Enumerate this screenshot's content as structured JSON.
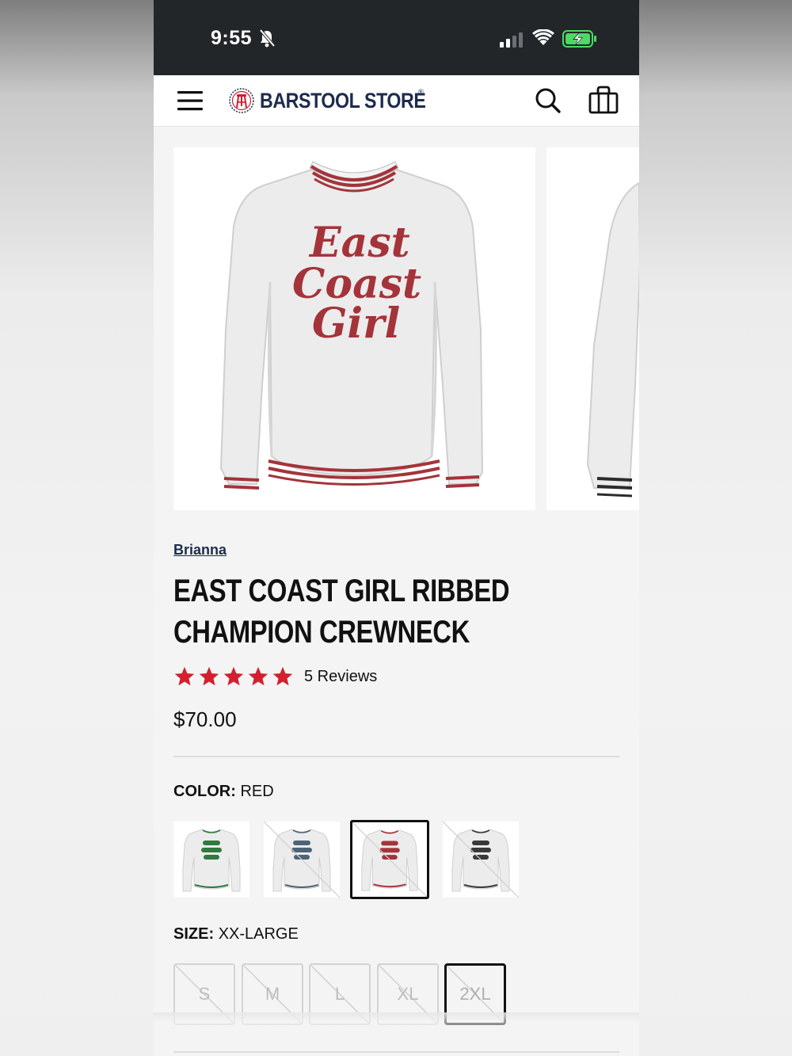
{
  "status_bar": {
    "time": "9:55"
  },
  "header": {
    "logo_text": "BARSTOOL STORE",
    "icons": [
      "menu-icon",
      "barstool-logo-icon",
      "search-icon",
      "bag-icon"
    ]
  },
  "gallery": {
    "main_image_text": [
      "East",
      "Coast",
      "Girl"
    ]
  },
  "product": {
    "brand": "Brianna",
    "title": "EAST COAST GIRL RIBBED CHAMPION CREWNECK",
    "rating": 5,
    "review_label": "5 Reviews",
    "price": "$70.00"
  },
  "color_option": {
    "label": "COLOR:",
    "value": "RED",
    "swatches": [
      {
        "color": "#2f7a3c",
        "available": true,
        "selected": false
      },
      {
        "color": "#4d6478",
        "available": false,
        "selected": false
      },
      {
        "color": "#a4343a",
        "available": false,
        "selected": true
      },
      {
        "color": "#3a3a3a",
        "available": false,
        "selected": false
      }
    ]
  },
  "size_option": {
    "label": "SIZE:",
    "value": "XX-LARGE",
    "sizes": [
      {
        "label": "S",
        "available": false,
        "selected": false
      },
      {
        "label": "M",
        "available": false,
        "selected": false
      },
      {
        "label": "L",
        "available": false,
        "selected": false
      },
      {
        "label": "XL",
        "available": false,
        "selected": false
      },
      {
        "label": "2XL",
        "available": false,
        "selected": true
      }
    ]
  },
  "colors": {
    "brand_navy": "#1d2b4d",
    "star_red": "#d3202f",
    "print_red": "#a4343a",
    "status_bar_bg": "#232629",
    "battery_green": "#4cd964"
  }
}
